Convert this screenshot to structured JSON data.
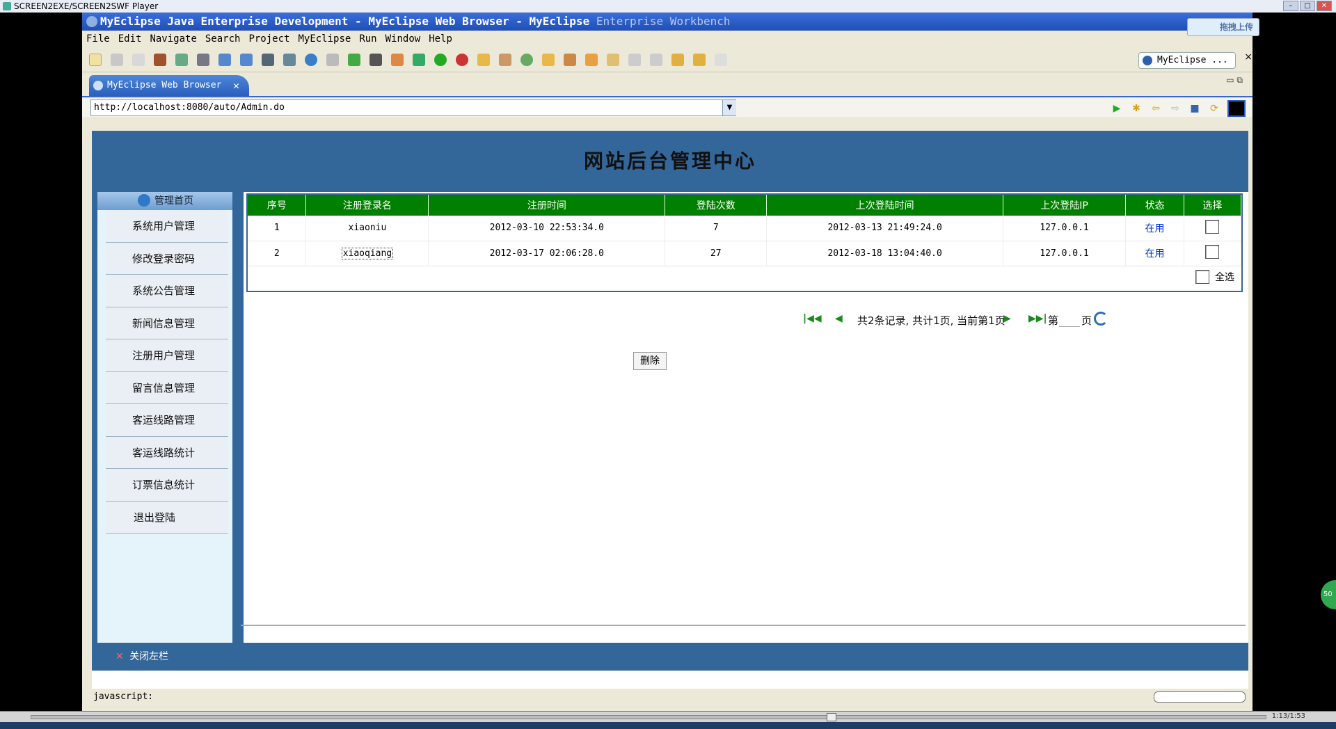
{
  "player": {
    "title": "SCREEN2EXE/SCREEN2SWF Player",
    "time": "1:13/1:53"
  },
  "ide": {
    "title_main": "MyEclipse Java Enterprise Development - MyEclipse Web Browser - MyEclipse",
    "title_faded": "Enterprise Workbench",
    "upload_label": "拖拽上传",
    "menus": [
      "File",
      "Edit",
      "Navigate",
      "Search",
      "Project",
      "MyEclipse",
      "Run",
      "Window",
      "Help"
    ],
    "perspective_label": "MyEclipse ...",
    "editor_tab": "MyEclipse Web Browser",
    "url": "http://localhost:8080/auto/Admin.do",
    "status_text": "javascript:"
  },
  "site": {
    "header_title": "网站后台管理中心",
    "sidebar": {
      "head": "管理首页",
      "items": [
        "系统用户管理",
        "修改登录密码",
        "系统公告管理",
        "新闻信息管理",
        "注册用户管理",
        "留言信息管理",
        "客运线路管理",
        "客运线路统计",
        "订票信息统计",
        "退出登陆"
      ]
    },
    "table": {
      "columns": [
        "序号",
        "注册登录名",
        "注册时间",
        "登陆次数",
        "上次登陆时间",
        "上次登陆IP",
        "状态",
        "选择"
      ],
      "rows": [
        {
          "no": "1",
          "login": "xiaoniu",
          "reg_time": "2012-03-10 22:53:34.0",
          "count": "7",
          "last_time": "2012-03-13 21:49:24.0",
          "ip": "127.0.0.1",
          "status": "在用"
        },
        {
          "no": "2",
          "login": "xiaoqiang",
          "reg_time": "2012-03-17 02:06:28.0",
          "count": "27",
          "last_time": "2012-03-18 13:04:40.0",
          "ip": "127.0.0.1",
          "status": "在用"
        }
      ],
      "select_all": "全选"
    },
    "pager": {
      "summary": "共2条记录, 共计1页, 当前第1页",
      "page_prefix": "第",
      "page_suffix": "页"
    },
    "delete_button": "删除",
    "close_sidebar": "关闭左栏"
  }
}
